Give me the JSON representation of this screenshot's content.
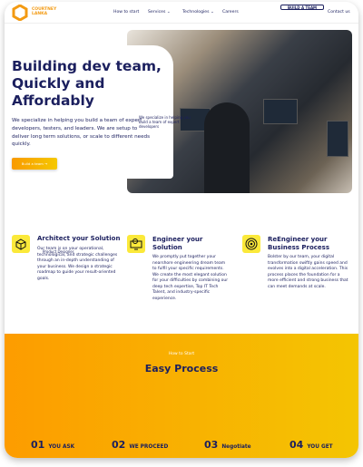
{
  "brand": {
    "name_line1": "COURTNEY",
    "name_line2": "LANKA",
    "color": "#f39a12"
  },
  "nav": {
    "items": [
      {
        "label": "How to start"
      },
      {
        "label": "Services"
      },
      {
        "label": "Technologies"
      },
      {
        "label": "Careers"
      }
    ],
    "build_team": "BUILD A TEAM",
    "contact": "Contact us"
  },
  "hero": {
    "title": "Building dev team, Quickly and Affordably",
    "text": "We specialize in helping you build a team of expert developers, testers, and leaders. We are setup to deliver long term solutions, or scale to different needs quickly.",
    "overlay_text": "We specialize in helping you build a team of expert developers",
    "cta": "Build a team →"
  },
  "features": [
    {
      "icon": "network-cube-icon",
      "title": "Architect your Solution",
      "overlay": "Product Designer",
      "text": "Our team is on your operational, technological, and strategic challenges through an in-depth understanding of your business. We design a strategic roadmap to guide your result-oriented goals."
    },
    {
      "icon": "monitor-gear-icon",
      "title": "Engineer your Solution",
      "text": "We promptly put together your nearshore engineering dream team to fulfil your specific requirements. We create the most elegant solution for your difficulties by combining our deep tech expertise, Top IT Tech Talent, and industry-specific experience."
    },
    {
      "icon": "target-cycle-icon",
      "title": "ReEngineer your Business Process",
      "text": "Bolster by our team, your digital transformation swiftly gains speed and evolves into a digital acceleration. This process places the foundation for a more efficient and strong business that can meet demands at scale."
    }
  ],
  "process": {
    "subtitle": "How to Start",
    "title": "Easy Process",
    "steps": [
      {
        "num": "01",
        "label": "YOU ASK"
      },
      {
        "num": "02",
        "label": "WE PROCEED"
      },
      {
        "num": "03",
        "label": "Negotiate"
      },
      {
        "num": "04",
        "label": "YOU GET"
      }
    ],
    "gradient": [
      "#fd9c00",
      "#f4c502"
    ]
  }
}
